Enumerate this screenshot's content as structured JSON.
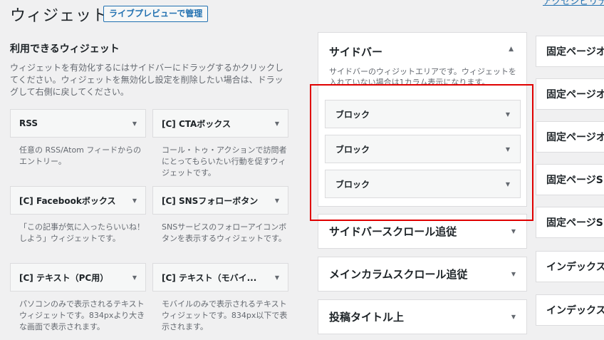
{
  "header": {
    "title": "ウィジェット",
    "live_preview_label": "ライブプレビューで管理",
    "top_link": "アクセシビリティ"
  },
  "available": {
    "title": "利用できるウィジェット",
    "description": "ウィジェットを有効化するにはサイドバーにドラッグするかクリックしてください。ウィジェットを無効化し設定を削除したい場合は、ドラッグして右側に戻してください。",
    "widgets": [
      {
        "label": "RSS",
        "desc": "任意の RSS/Atom フィードからのエントリー。"
      },
      {
        "label": "[C] CTAボックス",
        "desc": "コール・トゥ・アクションで訪問者にとってもらいたい行動を促すウィジェットです。"
      },
      {
        "label": "[C] Facebookボックス",
        "desc": "「この記事が気に入ったらいいね！しよう」ウィジェットです。"
      },
      {
        "label": "[C] SNSフォローボタン",
        "desc": "SNSサービスのフォローアイコンボタンを表示するウィジェットです。"
      },
      {
        "label": "[C] テキスト（PC用）",
        "desc": "パソコンのみで表示されるテキストウィジェットです。834pxより大きな画面で表示されます。"
      },
      {
        "label": "[C] テキスト（モバイ...",
        "desc": "モバイルのみで表示されるテキストウィジェットです。834px以下で表示されます。"
      }
    ]
  },
  "sidebar": {
    "title": "サイドバー",
    "description": "サイドバーのウィジットエリアです。ウィジェットを入れていない場合は1カラム表示になります。",
    "blocks": [
      {
        "label": "ブロック"
      },
      {
        "label": "ブロック"
      },
      {
        "label": "ブロック"
      }
    ]
  },
  "areas": [
    {
      "label": "サイドバースクロール追従"
    },
    {
      "label": "メインカラムスクロール追従"
    },
    {
      "label": "投稿タイトル上"
    }
  ],
  "right_areas": [
    {
      "label": "固定ページオ"
    },
    {
      "label": "固定ページオ"
    },
    {
      "label": "固定ページオ"
    },
    {
      "label": "固定ページS"
    },
    {
      "label": "固定ページS"
    },
    {
      "label": "インデックス"
    },
    {
      "label": "インデックス"
    }
  ],
  "icons": {
    "collapse": "▼",
    "expand": "▲"
  },
  "colors": {
    "highlight": "#e00000",
    "accent": "#2271b1"
  }
}
